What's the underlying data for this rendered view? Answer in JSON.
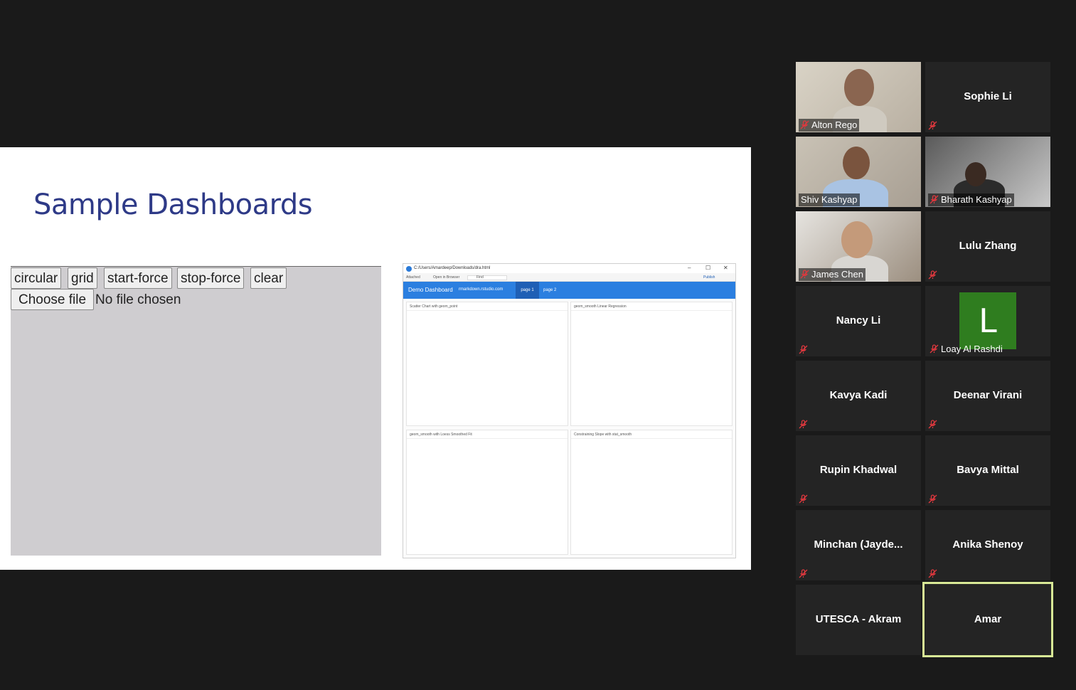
{
  "slide": {
    "title": "Sample Dashboards",
    "d3_demo": {
      "buttons": [
        "circular",
        "grid",
        "start-force",
        "stop-force",
        "clear"
      ],
      "file_button": "Choose file",
      "file_status": "No file chosen"
    },
    "rstudio_viewer": {
      "window_path": "C:/Users/Amardeep/Downloads/dra.html",
      "window_controls": [
        "–",
        "☐",
        "✕"
      ],
      "toolbar": {
        "attached": "Attached",
        "open_in_browser": "Open in Browser",
        "find_placeholder": "Find",
        "publish": "Publish"
      },
      "navbar": {
        "brand": "Demo Dashboard",
        "author": "rmarkdown.rstudio.com",
        "tabs": [
          "page 1",
          "page 2"
        ]
      },
      "cards": [
        "Scatter Chart with geom_point",
        "geom_smooth Linear Regression",
        "geom_smooth with Loess Smoothed Fit",
        "Constraining Slope with stat_smooth"
      ]
    }
  },
  "participants": [
    {
      "name": "Alton Rego",
      "video": true,
      "muted": true
    },
    {
      "name": "Sophie Li",
      "video": false,
      "muted": true
    },
    {
      "name": "Shiv Kashyap",
      "video": true,
      "muted": false
    },
    {
      "name": "Bharath Kashyap",
      "video": true,
      "muted": true
    },
    {
      "name": "James Chen",
      "video": true,
      "muted": true
    },
    {
      "name": "Lulu Zhang",
      "video": false,
      "muted": true
    },
    {
      "name": "Nancy Li",
      "video": false,
      "muted": true
    },
    {
      "name": "Loay Al Rashdi",
      "video": false,
      "muted": true,
      "avatar_letter": "L"
    },
    {
      "name": "Kavya Kadi",
      "video": false,
      "muted": true
    },
    {
      "name": "Deenar Virani",
      "video": false,
      "muted": true
    },
    {
      "name": "Rupin Khadwal",
      "video": false,
      "muted": true
    },
    {
      "name": "Bavya Mittal",
      "video": false,
      "muted": true
    },
    {
      "name": "Minchan  (Jayde...",
      "video": false,
      "muted": true
    },
    {
      "name": "Anika Shenoy",
      "video": false,
      "muted": true
    },
    {
      "name": "UTESCA - Akram",
      "video": false,
      "muted": false
    },
    {
      "name": "Amar",
      "video": false,
      "muted": false,
      "active_speaker": true
    }
  ],
  "colors": {
    "background": "#1a1a1a",
    "tile": "#242424",
    "slide_title": "#2e3a87",
    "mute": "#e0383e",
    "active_speaker_border": "#d8e896",
    "rstudio_navbar": "#2b7fe0",
    "avatar_l": "#2f7d1f"
  }
}
